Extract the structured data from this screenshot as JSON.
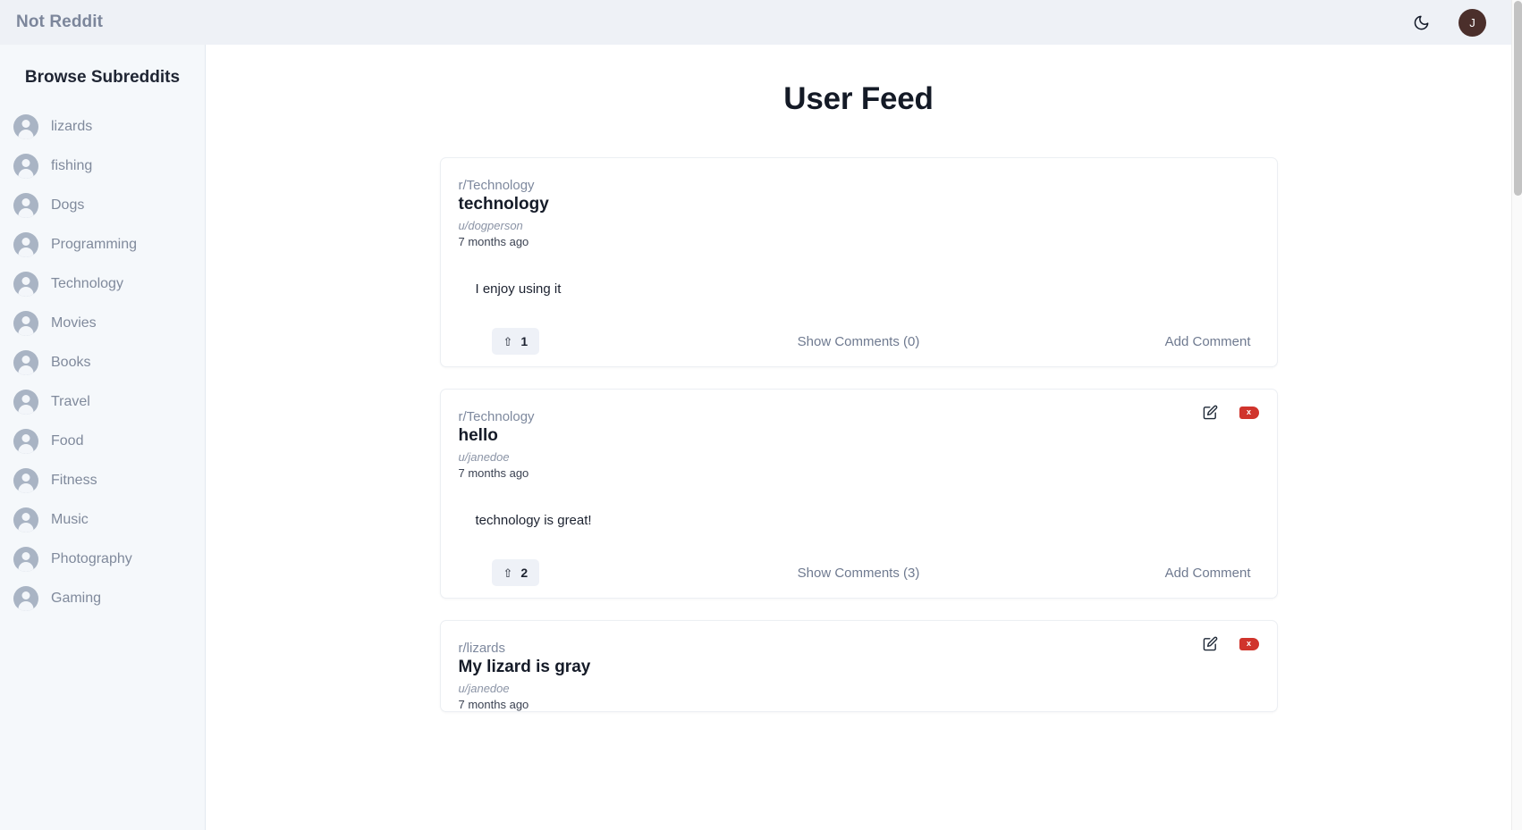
{
  "header": {
    "brand": "Not Reddit",
    "dark_mode_icon": "moon-icon",
    "avatar_initial": "J"
  },
  "sidebar": {
    "title": "Browse Subreddits",
    "items": [
      {
        "label": "lizards"
      },
      {
        "label": "fishing"
      },
      {
        "label": "Dogs"
      },
      {
        "label": "Programming"
      },
      {
        "label": "Technology"
      },
      {
        "label": "Movies"
      },
      {
        "label": "Books"
      },
      {
        "label": "Travel"
      },
      {
        "label": "Food"
      },
      {
        "label": "Fitness"
      },
      {
        "label": "Music"
      },
      {
        "label": "Photography"
      },
      {
        "label": "Gaming"
      }
    ]
  },
  "main": {
    "page_title": "User Feed",
    "posts": [
      {
        "subreddit": "r/Technology",
        "title": "technology",
        "author": "u/dogperson",
        "time": "7 months ago",
        "body": "I enjoy using it",
        "votes": "1",
        "vote_arrow": "⇧",
        "show_comments": "Show Comments (0)",
        "add_comment": "Add Comment",
        "has_owner_actions": false
      },
      {
        "subreddit": "r/Technology",
        "title": "hello",
        "author": "u/janedoe",
        "time": "7 months ago",
        "body": "technology is great!",
        "votes": "2",
        "vote_arrow": "⇧",
        "show_comments": "Show Comments (3)",
        "add_comment": "Add Comment",
        "has_owner_actions": true,
        "edit_icon": "edit-pencil-icon",
        "delete_icon": "delete-x-icon",
        "delete_label": "x"
      },
      {
        "subreddit": "r/lizards",
        "title": "My lizard is gray",
        "author": "u/janedoe",
        "time": "7 months ago",
        "body": "",
        "votes": "",
        "vote_arrow": "⇧",
        "show_comments": "",
        "add_comment": "",
        "has_owner_actions": true,
        "edit_icon": "edit-pencil-icon",
        "delete_icon": "delete-x-icon",
        "delete_label": "x"
      }
    ]
  },
  "colors": {
    "topbar_bg": "#eef1f6",
    "sidebar_bg": "#f5f8fb",
    "brand_text": "#7c869b",
    "avatar_bg": "#4b2f2b",
    "delete_red": "#d0342c",
    "muted_text": "#6f7a90",
    "title_text": "#141a26"
  }
}
